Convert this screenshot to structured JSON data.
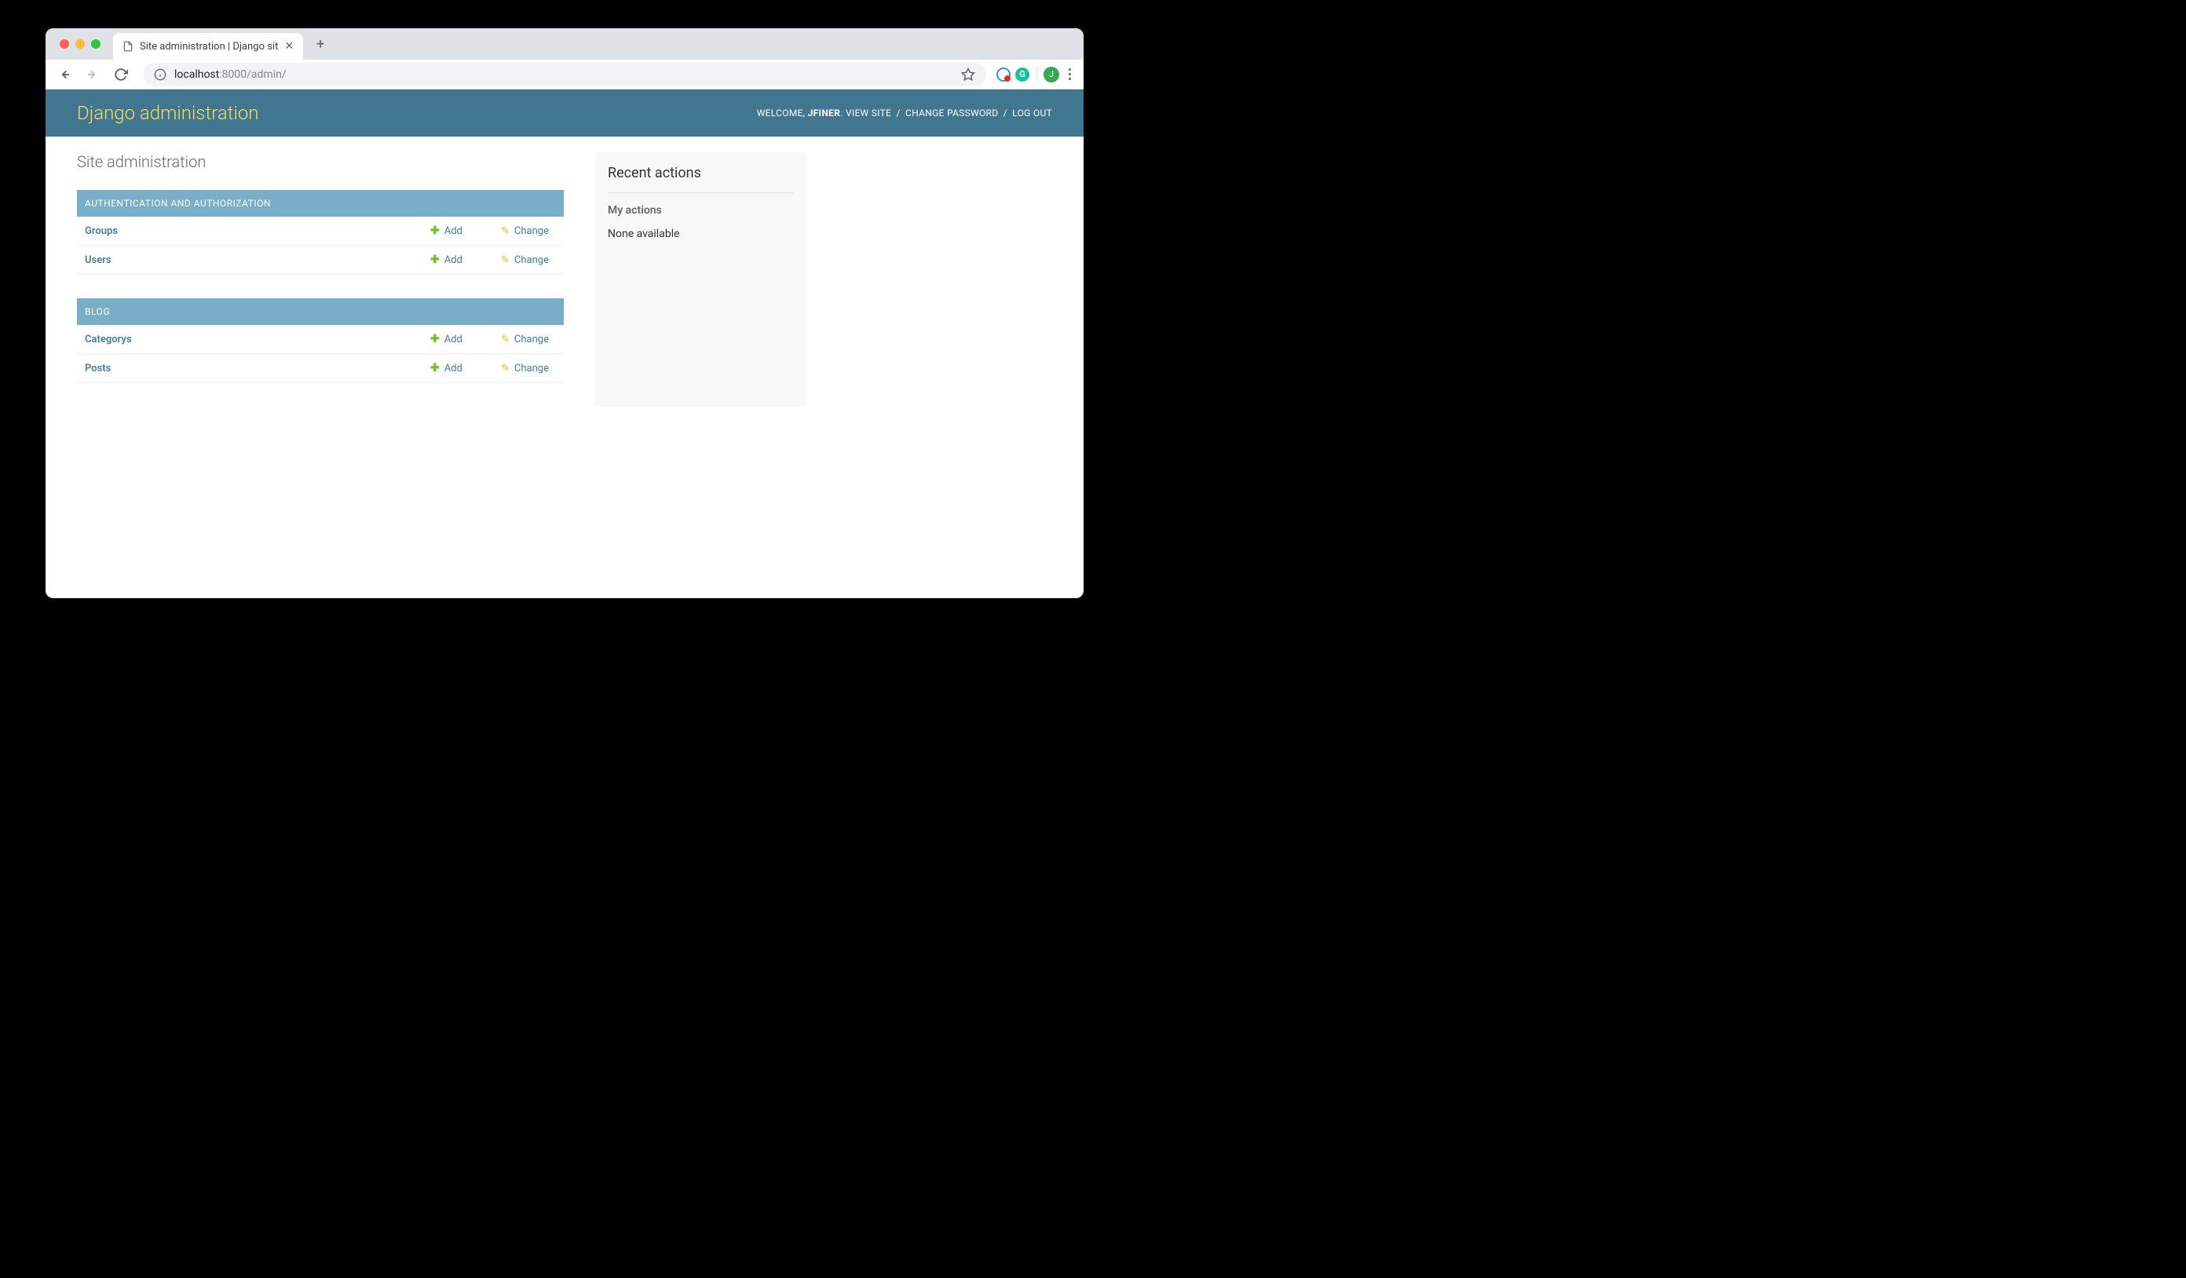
{
  "browser": {
    "tab_title": "Site administration | Django sit",
    "url_host": "localhost",
    "url_port": ":8000",
    "url_path": "/admin/",
    "avatar_letter": "J"
  },
  "header": {
    "title": "Django administration",
    "welcome_prefix": "WELCOME, ",
    "username": "JFINER",
    "view_site": "VIEW SITE",
    "change_password": "CHANGE PASSWORD",
    "log_out": "LOG OUT"
  },
  "page_title": "Site administration",
  "modules": [
    {
      "name": "AUTHENTICATION AND AUTHORIZATION",
      "models": [
        {
          "name": "Groups",
          "add": "Add",
          "change": "Change"
        },
        {
          "name": "Users",
          "add": "Add",
          "change": "Change"
        }
      ]
    },
    {
      "name": "BLOG",
      "models": [
        {
          "name": "Categorys",
          "add": "Add",
          "change": "Change"
        },
        {
          "name": "Posts",
          "add": "Add",
          "change": "Change"
        }
      ]
    }
  ],
  "recent_actions": {
    "title": "Recent actions",
    "subtitle": "My actions",
    "none": "None available"
  }
}
